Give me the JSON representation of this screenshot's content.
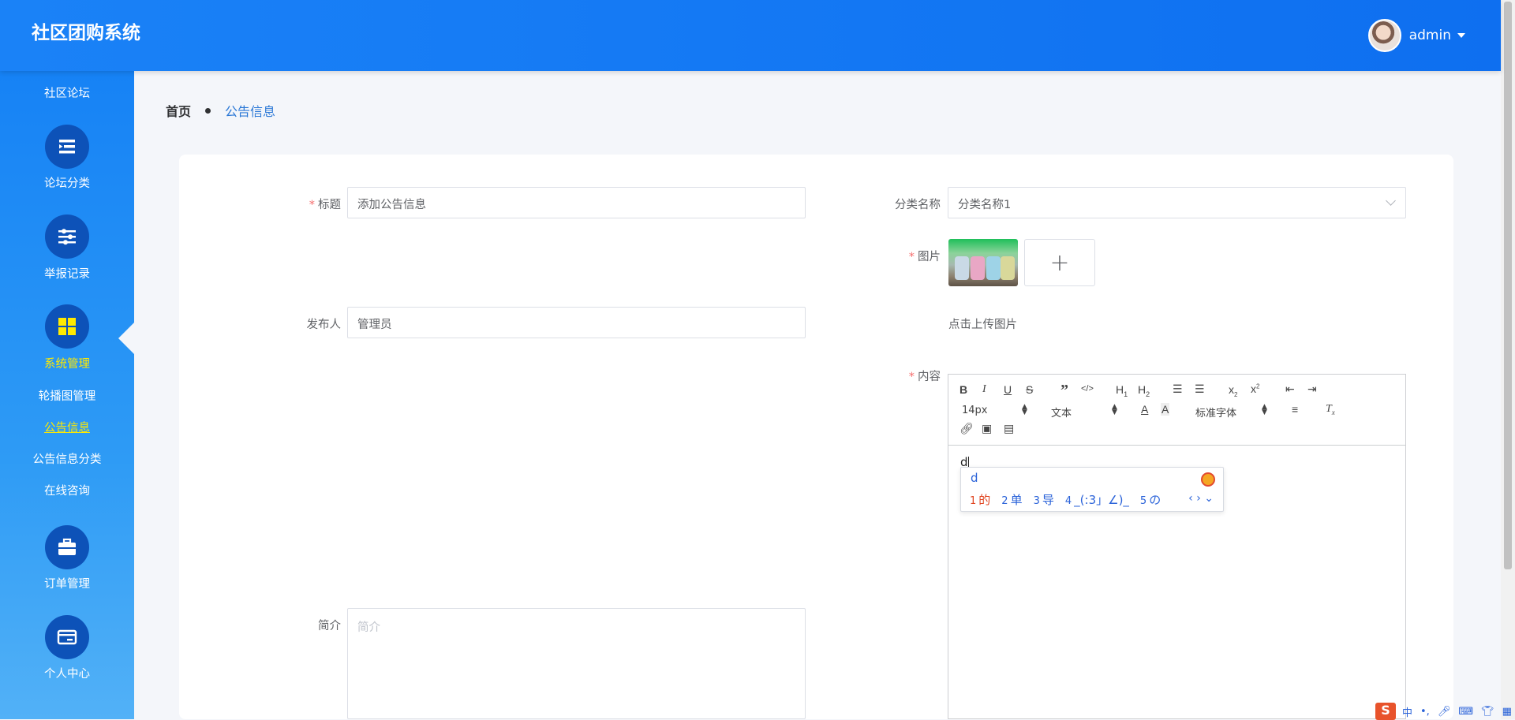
{
  "header": {
    "app_title": "社区团购系统",
    "username": "admin"
  },
  "sidebar": {
    "top_link": "社区论坛",
    "items": [
      {
        "label": "论坛分类",
        "icon": "menu-list-icon"
      },
      {
        "label": "举报记录",
        "icon": "sliders-icon"
      },
      {
        "label": "系统管理",
        "icon": "grid-icon",
        "active": true
      },
      {
        "label": "订单管理",
        "icon": "briefcase-icon"
      },
      {
        "label": "个人中心",
        "icon": "wallet-card-icon"
      }
    ],
    "sub_items": [
      {
        "label": "轮播图管理"
      },
      {
        "label": "公告信息",
        "active": true
      },
      {
        "label": "公告信息分类"
      },
      {
        "label": "在线咨询"
      }
    ]
  },
  "breadcrumb": {
    "home": "首页",
    "current": "公告信息"
  },
  "form": {
    "title_label": "标题",
    "title_value": "添加公告信息",
    "category_label": "分类名称",
    "category_value": "分类名称1",
    "image_label": "图片",
    "upload_plus": "+",
    "upload_hint": "点击上传图片",
    "publisher_label": "发布人",
    "publisher_value": "管理员",
    "content_label": "内容",
    "summary_label": "简介",
    "summary_placeholder": "简介"
  },
  "editor": {
    "font_size": "14px",
    "header_select": "文本",
    "font_family": "标准字体",
    "content_text": "d"
  },
  "ime": {
    "input": "d",
    "candidates": [
      {
        "num": "1",
        "text": "的"
      },
      {
        "num": "2",
        "text": "单"
      },
      {
        "num": "3",
        "text": "导"
      },
      {
        "num": "4",
        "text": "_(:3」∠)_"
      },
      {
        "num": "5",
        "text": "の"
      }
    ]
  },
  "tray": {
    "logo": "S",
    "lang": "中"
  },
  "colors": {
    "header_bg": "#1a82f7",
    "sidebar_bg": "#1682f5",
    "active_menu": "#ffea00",
    "required_mark": "#f56c6c",
    "link_blue": "#2b78d6"
  }
}
